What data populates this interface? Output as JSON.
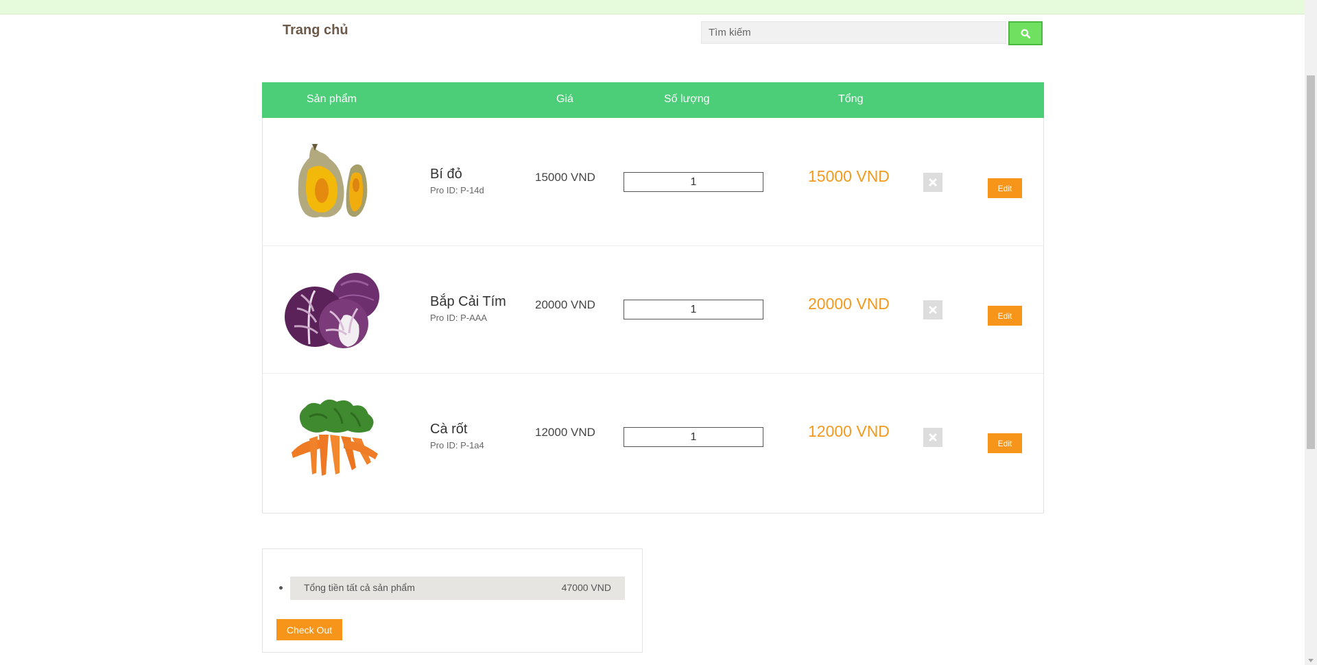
{
  "header": {
    "home_label": "Trang chủ",
    "search_placeholder": "Tìm kiếm"
  },
  "table": {
    "columns": {
      "product": "Sản phẩm",
      "price": "Giá",
      "quantity": "Số lượng",
      "total": "Tổng"
    },
    "rows": [
      {
        "name": "Bí đỏ",
        "pro_id": "Pro ID: P-14d",
        "price": "15000 VND",
        "quantity": "1",
        "total": "15000 VND",
        "edit_label": "Edit",
        "image": "butternut-pumpkin"
      },
      {
        "name": "Bắp Cải Tím",
        "pro_id": "Pro ID: P-AAA",
        "price": "20000 VND",
        "quantity": "1",
        "total": "20000 VND",
        "edit_label": "Edit",
        "image": "red-cabbage"
      },
      {
        "name": "Cà rốt",
        "pro_id": "Pro ID: P-1a4",
        "price": "12000 VND",
        "quantity": "1",
        "total": "12000 VND",
        "edit_label": "Edit",
        "image": "carrots"
      }
    ]
  },
  "summary": {
    "total_label": "Tổng tiền tất cả sản phẩm",
    "total_value": "47000 VND",
    "checkout_label": "Check Out"
  },
  "icons": {
    "search": "search-icon",
    "remove": "remove-icon"
  },
  "colors": {
    "table_header": "#4ccd78",
    "search_button": "#6fe05f",
    "accent_orange": "#f7951a",
    "price_total": "#f39a1e"
  }
}
